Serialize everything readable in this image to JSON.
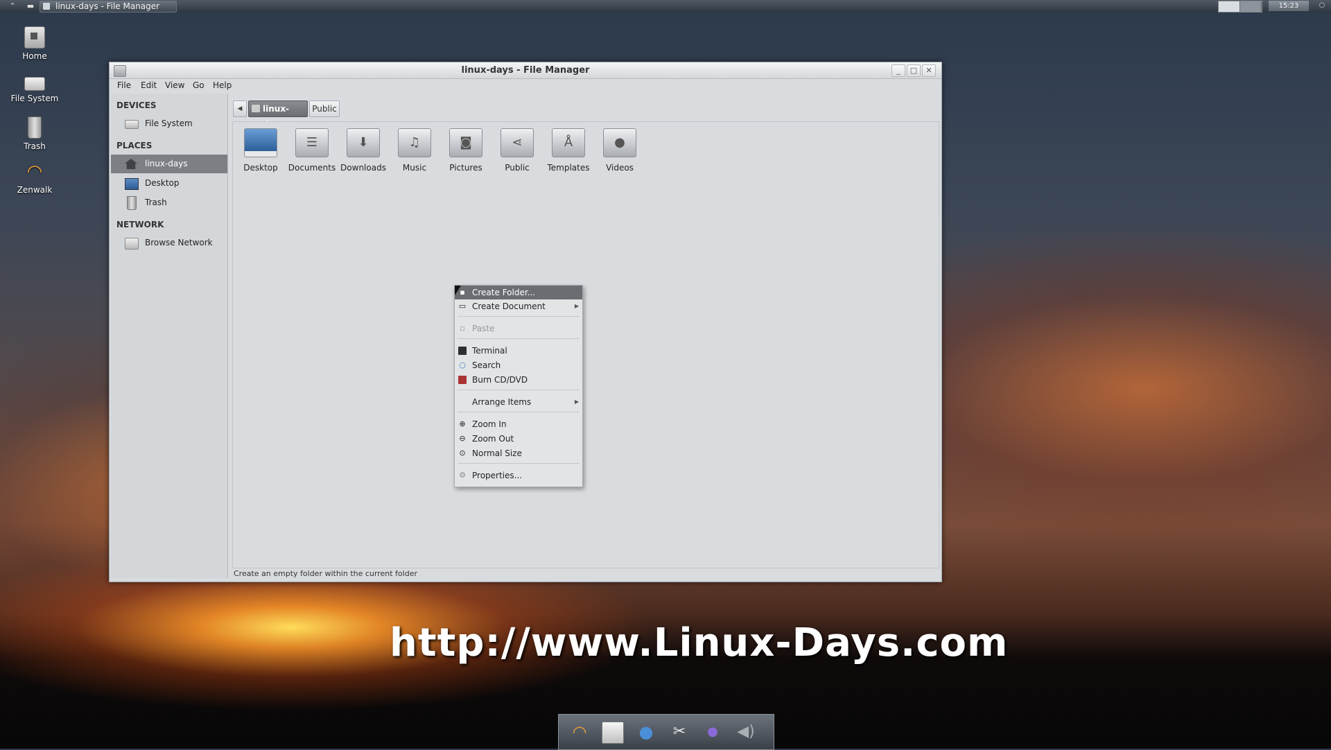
{
  "top_panel": {
    "task_title": "linux-days - File Manager",
    "clock": "15:23"
  },
  "desktop": {
    "icons": [
      {
        "label": "Home",
        "icon": "home-icon"
      },
      {
        "label": "File System",
        "icon": "drive-icon"
      },
      {
        "label": "Trash",
        "icon": "trash-icon"
      },
      {
        "label": "Zenwalk",
        "icon": "zenwalk-icon"
      }
    ]
  },
  "window": {
    "title": "linux-days - File Manager",
    "menu": [
      "File",
      "Edit",
      "View",
      "Go",
      "Help"
    ],
    "sidebar": {
      "devices_header": "DEVICES",
      "devices": [
        {
          "label": "File System",
          "icon": "drive-icon"
        }
      ],
      "places_header": "PLACES",
      "places": [
        {
          "label": "linux-days",
          "icon": "home-icon",
          "selected": true
        },
        {
          "label": "Desktop",
          "icon": "desktop-icon"
        },
        {
          "label": "Trash",
          "icon": "trash-icon"
        }
      ],
      "network_header": "NETWORK",
      "network": [
        {
          "label": "Browse Network",
          "icon": "network-icon"
        }
      ]
    },
    "pathbar": {
      "current": "linux-days",
      "next": "Public"
    },
    "files": [
      {
        "label": "Desktop",
        "icon": "desktop-folder-icon"
      },
      {
        "label": "Documents",
        "icon": "documents-folder-icon"
      },
      {
        "label": "Downloads",
        "icon": "downloads-folder-icon"
      },
      {
        "label": "Music",
        "icon": "music-folder-icon"
      },
      {
        "label": "Pictures",
        "icon": "pictures-folder-icon"
      },
      {
        "label": "Public",
        "icon": "public-folder-icon"
      },
      {
        "label": "Templates",
        "icon": "templates-folder-icon"
      },
      {
        "label": "Videos",
        "icon": "videos-folder-icon"
      }
    ],
    "status": "Create an empty folder within the current folder"
  },
  "context_menu": {
    "items": [
      {
        "label": "Create Folder...",
        "icon": "folder-new-icon",
        "highlighted": true
      },
      {
        "label": "Create Document",
        "icon": "document-new-icon",
        "submenu": true
      },
      {
        "label": "Paste",
        "icon": "paste-icon",
        "disabled": true
      },
      {
        "label": "Terminal",
        "icon": "terminal-icon"
      },
      {
        "label": "Search",
        "icon": "search-icon"
      },
      {
        "label": "Burn CD/DVD",
        "icon": "burn-icon"
      },
      {
        "label": "Arrange Items",
        "icon": "",
        "submenu": true
      },
      {
        "label": "Zoom In",
        "icon": "zoom-in-icon"
      },
      {
        "label": "Zoom Out",
        "icon": "zoom-out-icon"
      },
      {
        "label": "Normal Size",
        "icon": "zoom-normal-icon"
      },
      {
        "label": "Properties...",
        "icon": "properties-icon"
      }
    ]
  },
  "watermark": "http://www.Linux-Days.com",
  "dock": {
    "items": [
      "zenwalk-icon",
      "file-manager-icon",
      "browser-globe-icon",
      "settings-tools-icon",
      "messenger-icon",
      "volume-icon"
    ]
  }
}
